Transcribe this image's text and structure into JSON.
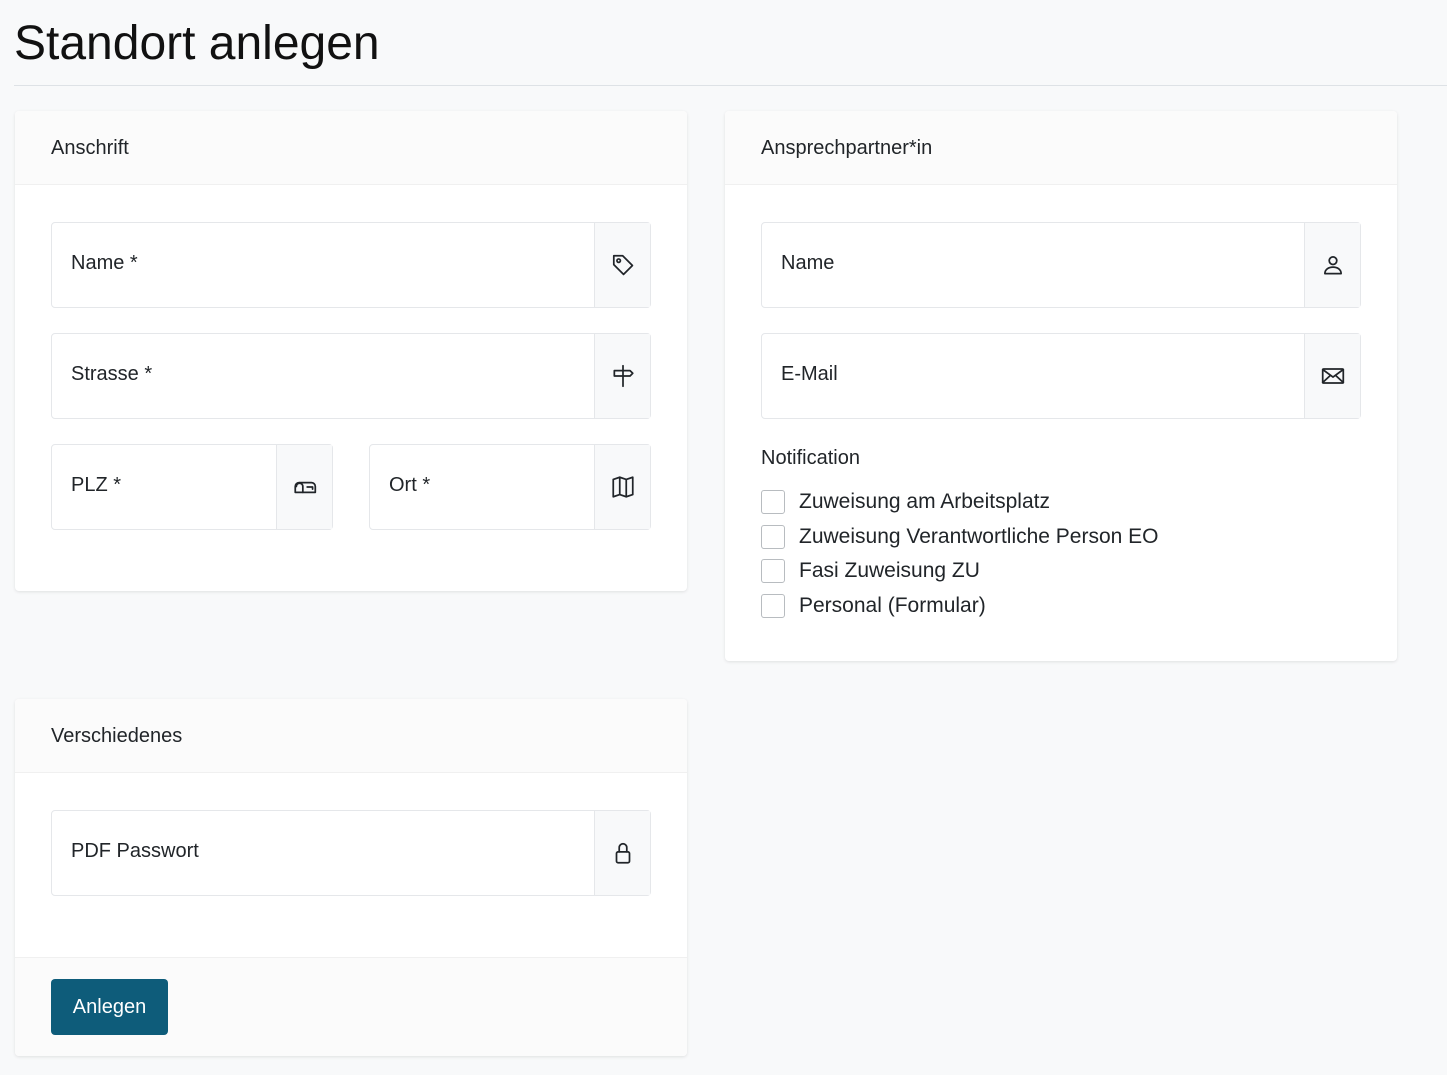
{
  "page": {
    "title": "Standort anlegen"
  },
  "anschrift": {
    "header": "Anschrift",
    "name_label": "Name *",
    "name_icon": "tag-icon",
    "strasse_label": "Strasse *",
    "strasse_icon": "signpost-icon",
    "plz_label": "PLZ *",
    "plz_icon": "mailbox-icon",
    "ort_label": "Ort *",
    "ort_icon": "map-icon"
  },
  "kontakt": {
    "header": "Ansprechpartner*in",
    "name_label": "Name",
    "name_icon": "person-icon",
    "email_label": "E-Mail",
    "email_icon": "envelope-icon",
    "notification_heading": "Notification",
    "notifications": [
      {
        "label": "Zuweisung am Arbeitsplatz",
        "checked": false
      },
      {
        "label": "Zuweisung Verantwortliche Person EO",
        "checked": false
      },
      {
        "label": "Fasi Zuweisung ZU",
        "checked": false
      },
      {
        "label": "Personal (Formular)",
        "checked": false
      }
    ]
  },
  "verschiedenes": {
    "header": "Verschiedenes",
    "pdf_label": "PDF Passwort",
    "pdf_icon": "lock-icon",
    "submit_label": "Anlegen"
  },
  "colors": {
    "primary_button": "#0e5c7a",
    "page_background": "#f8f9fa"
  }
}
